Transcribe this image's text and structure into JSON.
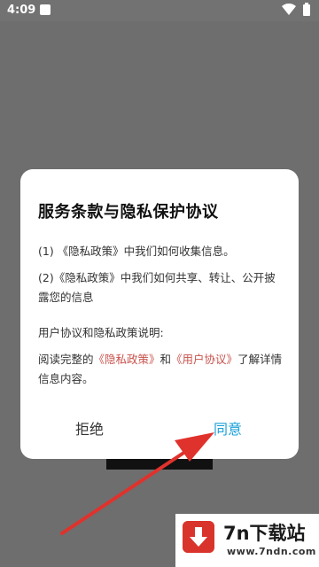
{
  "status_bar": {
    "time": "4:09"
  },
  "dialog": {
    "title": "服务条款与隐私保护协议",
    "item1": "(1) 《隐私政策》中我们如何收集信息。",
    "item2": "(2)《隐私政策》中我们如何共享、转让、公开披露您的信息",
    "note_heading": "用户协议和隐私政策说明:",
    "note_prefix": "阅读完整的",
    "privacy_link": "《隐私政策》",
    "note_and": "和",
    "user_link": "《用户协议》",
    "note_suffix": "了解详情信息内容。",
    "refuse_label": "拒绝",
    "agree_label": "同意"
  },
  "watermark": {
    "title": "7n下载站",
    "url": "www.7ndn.com"
  },
  "colors": {
    "accent": "#1aa0d8",
    "link": "#c8524c",
    "arrow": "#e0322c",
    "overlay": "#6e6e6e"
  }
}
